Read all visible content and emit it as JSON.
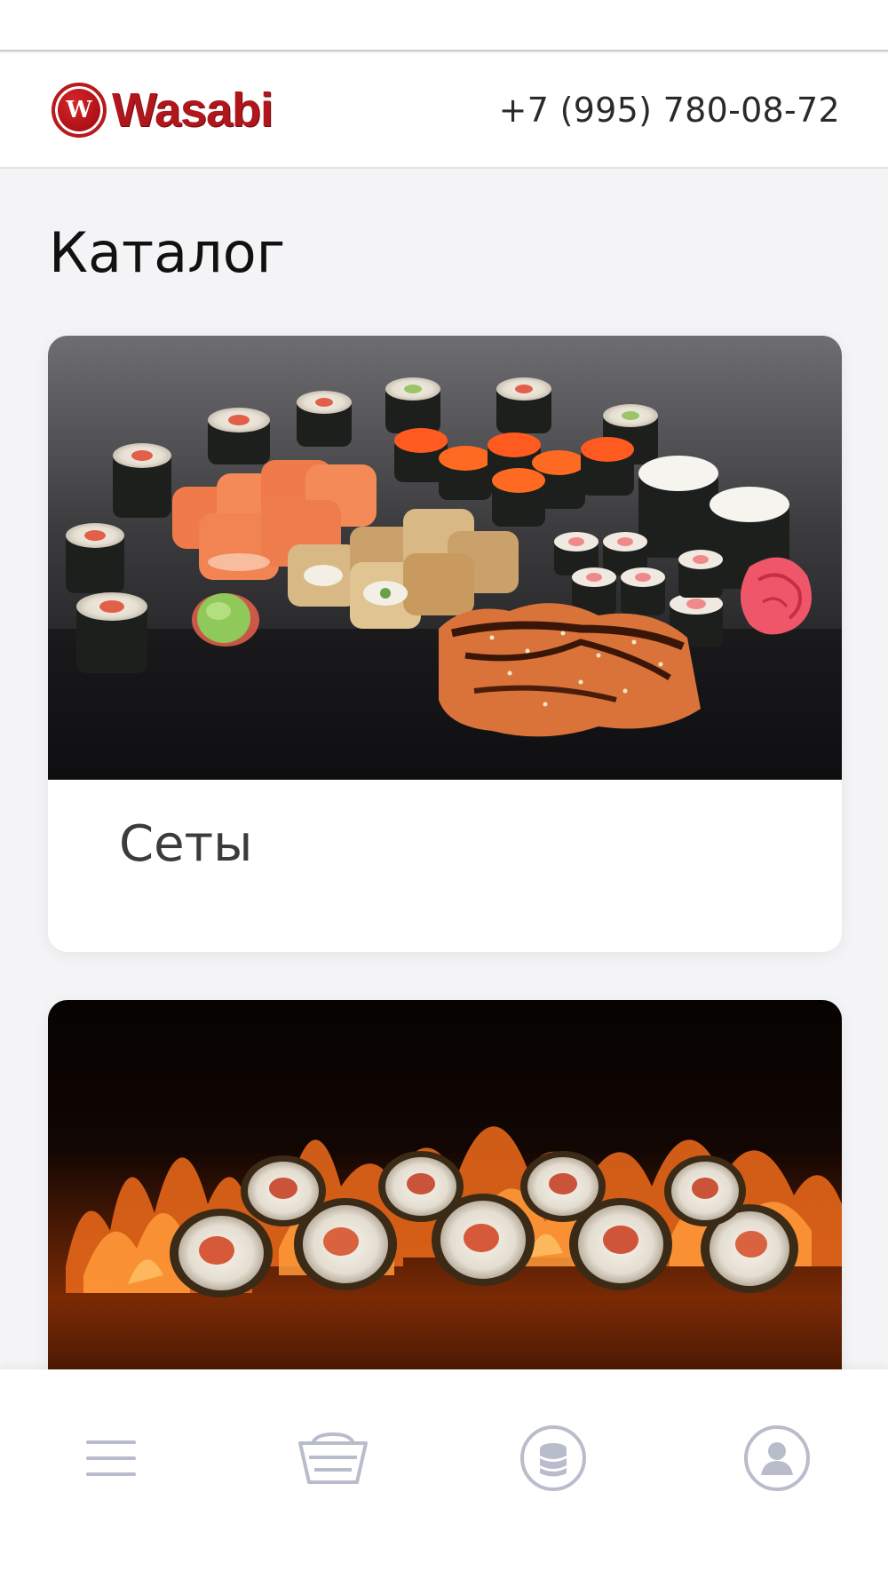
{
  "header": {
    "logo_text": "Wasabi",
    "logo_mark_letter": "W",
    "phone": "+7 (995) 780-08-72"
  },
  "page": {
    "title": "Каталог"
  },
  "catalog": {
    "categories": [
      {
        "label": "Сеты",
        "image": "sushi-set-photo"
      },
      {
        "label": "",
        "image": "hot-rolls-fire-photo"
      }
    ]
  },
  "bottom_nav": {
    "items": [
      {
        "icon": "menu-icon"
      },
      {
        "icon": "basket-icon"
      },
      {
        "icon": "coins-icon"
      },
      {
        "icon": "profile-icon"
      }
    ]
  },
  "colors": {
    "brand_red": "#b0161b",
    "nav_icon": "#b9bccb",
    "background": "#f4f4f6"
  }
}
